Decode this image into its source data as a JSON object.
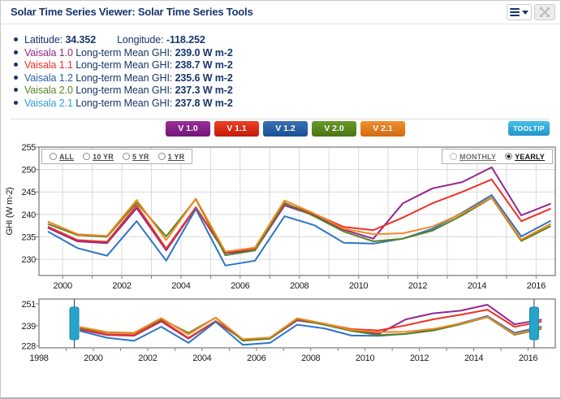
{
  "header": {
    "title": "Solar Time Series Viewer: Solar Time Series Tools"
  },
  "info": {
    "location": {
      "lat_label": "Latitude:",
      "lat_value": "34.352",
      "lon_label": "Longitude:",
      "lon_value": "-118.252"
    },
    "series_means": [
      {
        "name": "Vaisala 1.0",
        "color": "#92278f",
        "label": "Long-term Mean GHI:",
        "value": "239.0 W m-2"
      },
      {
        "name": "Vaisala 1.1",
        "color": "#ee3124",
        "label": "Long-term Mean GHI:",
        "value": "238.7 W m-2"
      },
      {
        "name": "Vaisala 1.2",
        "color": "#2a62a8",
        "label": "Long-term Mean GHI:",
        "value": "235.6 W m-2"
      },
      {
        "name": "Vaisala 2.0",
        "color": "#568423",
        "label": "Long-term Mean GHI:",
        "value": "237.3 W m-2"
      },
      {
        "name": "Vaisala 2.1",
        "color": "#2f9cd8",
        "label": "Long-term Mean GHI:",
        "value": "237.8 W m-2"
      }
    ]
  },
  "toolbar": {
    "version_buttons": [
      {
        "label": "V 1.0",
        "color_top": "#9b2d9b",
        "color_bottom": "#711677"
      },
      {
        "label": "V 1.1",
        "color_top": "#ef4023",
        "color_bottom": "#c41a0b"
      },
      {
        "label": "V 1.2",
        "color_top": "#3a71b5",
        "color_bottom": "#1c5096"
      },
      {
        "label": "V 2.0",
        "color_top": "#699a2a",
        "color_bottom": "#4a7413"
      },
      {
        "label": "V 2.1",
        "color_top": "#f29030",
        "color_bottom": "#d06a10"
      }
    ],
    "tooltip_button": {
      "label": "TOOLTIP",
      "color": "#2aa9dd"
    }
  },
  "main_controls": {
    "period_options": [
      "ALL",
      "10 YR",
      "5 YR",
      "1 YR"
    ],
    "period_selected": "",
    "granularity_options": [
      "MONTHLY",
      "YEARLY"
    ],
    "granularity_selected": "YEARLY"
  },
  "chart_data": {
    "type": "line",
    "x": [
      1999.5,
      2000.5,
      2001.5,
      2002.5,
      2003.5,
      2004.5,
      2005.5,
      2006.5,
      2007.5,
      2008.5,
      2009.5,
      2010.5,
      2011.5,
      2012.5,
      2013.5,
      2014.5,
      2015.5,
      2016.5
    ],
    "series": [
      {
        "name": "V 1.0",
        "color": "#92278f",
        "values": [
          237.0,
          234.0,
          233.6,
          241.4,
          232.0,
          241.5,
          231.4,
          232.0,
          242.0,
          239.8,
          236.6,
          234.6,
          242.5,
          245.8,
          247.2,
          250.5,
          239.8,
          242.4
        ]
      },
      {
        "name": "V 1.1",
        "color": "#ee3124",
        "values": [
          237.3,
          234.3,
          233.9,
          242.0,
          232.4,
          241.6,
          231.6,
          232.4,
          242.4,
          240.1,
          237.2,
          236.5,
          239.3,
          242.5,
          245.0,
          247.8,
          238.5,
          241.3
        ]
      },
      {
        "name": "V 1.2",
        "color": "#2e74c4",
        "values": [
          236.2,
          232.5,
          230.8,
          238.5,
          229.7,
          241.2,
          228.6,
          229.7,
          239.6,
          237.6,
          233.7,
          233.5,
          234.6,
          236.8,
          240.4,
          244.3,
          235.1,
          238.6
        ]
      },
      {
        "name": "V 2.0",
        "color": "#568423",
        "values": [
          237.9,
          235.4,
          235.0,
          242.6,
          235.1,
          243.4,
          230.9,
          232.0,
          242.6,
          239.6,
          236.2,
          234.0,
          234.6,
          236.4,
          239.8,
          243.7,
          234.1,
          237.4
        ]
      },
      {
        "name": "V 2.1",
        "color": "#f5861f",
        "values": [
          238.4,
          235.6,
          235.2,
          243.2,
          234.3,
          243.5,
          231.7,
          232.6,
          243.1,
          240.2,
          236.8,
          235.6,
          235.8,
          237.3,
          240.2,
          243.8,
          234.4,
          237.9
        ]
      }
    ],
    "main_chart": {
      "ylabel": "GHI (W m-2)",
      "yticks": [
        230,
        235,
        240,
        245,
        250,
        255
      ],
      "xticks": [
        2000,
        2002,
        2004,
        2006,
        2008,
        2010,
        2012,
        2014,
        2016
      ],
      "xlim": [
        1999.2,
        2016.65
      ],
      "ylim": [
        226.4,
        255
      ],
      "grid": true
    },
    "overview_chart": {
      "yticks": [
        228,
        239,
        251
      ],
      "xticks": [
        1998,
        2000,
        2002,
        2004,
        2006,
        2008,
        2010,
        2012,
        2014,
        2016
      ],
      "xlim": [
        1998,
        2017.0
      ],
      "ylim": [
        227.0,
        253.6
      ],
      "selection": [
        1999.3,
        2016.22
      ],
      "handle_color": "#27a4cc"
    }
  }
}
